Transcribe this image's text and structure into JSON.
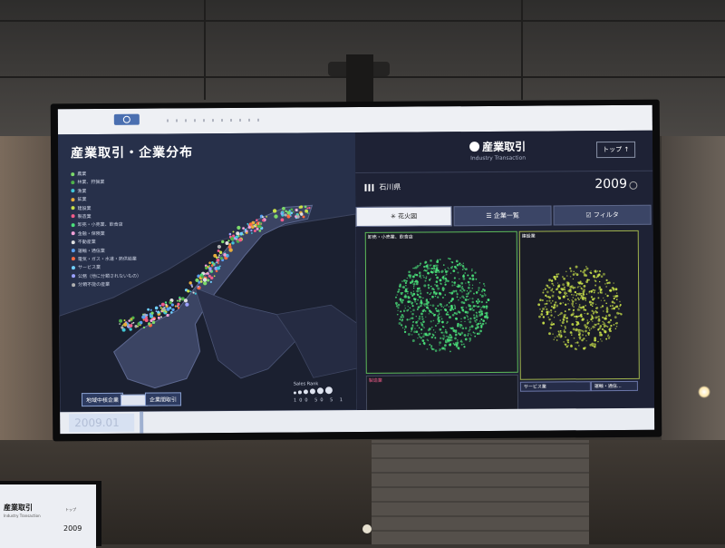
{
  "left_panel": {
    "title": "産業取引・企業分布",
    "legend": [
      {
        "label": "農業",
        "color": "#7bd96a"
      },
      {
        "label": "林業、狩猟業",
        "color": "#4fb24a"
      },
      {
        "label": "漁業",
        "color": "#40c6d8"
      },
      {
        "label": "鉱業",
        "color": "#e7ad3d"
      },
      {
        "label": "建設業",
        "color": "#c8e04a"
      },
      {
        "label": "製造業",
        "color": "#f25c8a"
      },
      {
        "label": "卸売・小売業、飲食店",
        "color": "#4ae07a"
      },
      {
        "label": "金融・保険業",
        "color": "#f0a0d8"
      },
      {
        "label": "不動産業",
        "color": "#e0e0e0"
      },
      {
        "label": "運輸・通信業",
        "color": "#5aa0f0"
      },
      {
        "label": "電気・ガス・水道・熱供給業",
        "color": "#ff6a40"
      },
      {
        "label": "サービス業",
        "color": "#70d0ff"
      },
      {
        "label": "公務（他に分類されないもの）",
        "color": "#9aa0ff"
      },
      {
        "label": "分類不能の産業",
        "color": "#b0b0b0"
      }
    ],
    "buttons": {
      "left": "地域中核企業",
      "right": "企業間取引"
    },
    "sales_rank": {
      "label": "Sales Rank",
      "scale": [
        "100",
        "50",
        "5",
        "1"
      ]
    }
  },
  "right_panel": {
    "title": "産業取引",
    "subtitle": "Industry Transaction",
    "top_button": "トップ ↑",
    "prefecture": "石川県",
    "year": "2009",
    "tabs": [
      {
        "label": "花火図",
        "icon": "sparkle-icon",
        "active": true
      },
      {
        "label": "企業一覧",
        "icon": "list-icon",
        "active": false
      },
      {
        "label": "フィルタ",
        "icon": "checkbox-icon",
        "active": false
      }
    ],
    "tiles": [
      {
        "label": "卸売・小売業、飲食店",
        "color": "#4ae07a"
      },
      {
        "label": "建設業",
        "color": "#c8e04a"
      },
      {
        "label": "製造業",
        "color": "#f25c8a"
      },
      {
        "label": "サービス業",
        "color": "#70d0ff"
      },
      {
        "label": "運輸・通信...",
        "color": "#5aa0f0"
      }
    ]
  },
  "timeline": {
    "year_label": "2009.01"
  },
  "second_display": {
    "title": "産業取引",
    "subtitle": "Industry Transaction",
    "top_button": "トップ",
    "year": "2009"
  }
}
